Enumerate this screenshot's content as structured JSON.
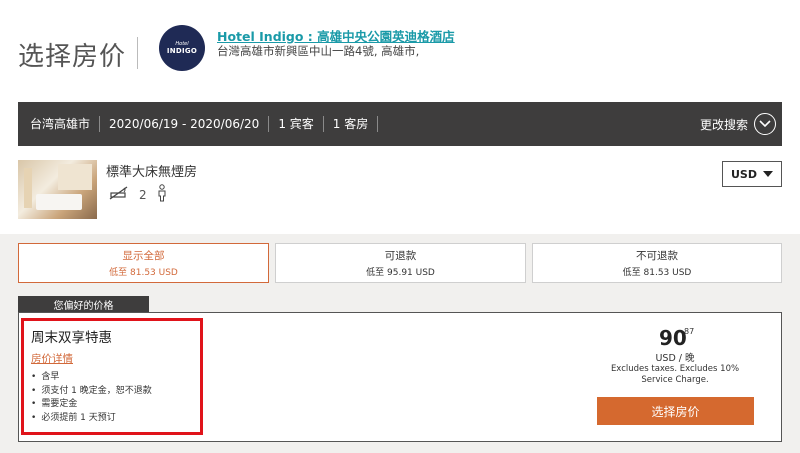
{
  "header": {
    "page_title": "选择房价",
    "logo_line1": "Hotel",
    "logo_line2": "INDIGO",
    "hotel_name": "Hotel Indigo : 高雄中央公園英迪格酒店",
    "hotel_address": "台灣高雄市新興區中山一路4號, 高雄市,"
  },
  "search": {
    "location": "台湾高雄市",
    "dates": "2020/06/19 - 2020/06/20",
    "guests": "1 宾客",
    "rooms": "1 客房",
    "change_label": "更改搜索"
  },
  "room": {
    "name": "標準大床無煙房",
    "occupancy": "2",
    "icons": [
      "no-smoking-icon",
      "person-icon"
    ]
  },
  "currency": {
    "selected": "USD"
  },
  "filters": [
    {
      "label": "显示全部",
      "price": "低至 81.53 USD",
      "active": true
    },
    {
      "label": "可退款",
      "price": "低至 95.91 USD",
      "active": false
    },
    {
      "label": "不可退款",
      "price": "低至 81.53 USD",
      "active": false
    }
  ],
  "rate": {
    "preferred_label": "您偏好的价格",
    "title": "周末双享特惠",
    "details_link": "房价详情",
    "features": [
      "含早",
      "须支付 1 晚定金，恕不退款",
      "需要定金",
      "必须提前 1 天预订"
    ],
    "price_whole": "90",
    "price_cents": "87",
    "price_unit": "USD / 晚",
    "price_note": "Excludes taxes. Excludes 10% Service Charge.",
    "select_label": "选择房价"
  },
  "colors": {
    "accent": "#d5692f",
    "dark_bar": "#3e3d3d",
    "link": "#1a9aa8",
    "highlight": "#e0131a"
  }
}
